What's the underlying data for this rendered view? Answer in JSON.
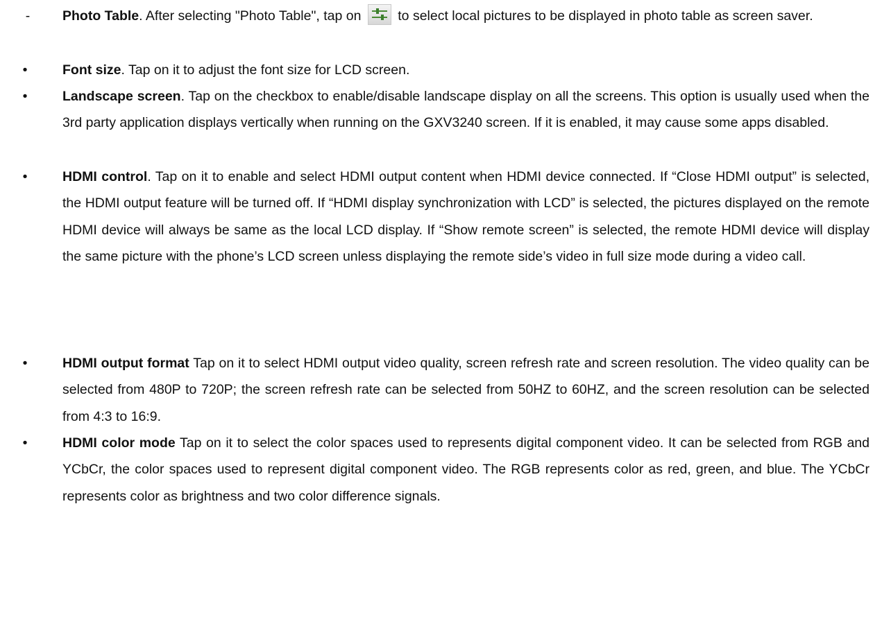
{
  "items": [
    {
      "marker": "-",
      "term": "Photo Table",
      "before_icon": ". After selecting \"Photo Table\", tap on ",
      "icon": "sliders-icon",
      "after_icon": " to select local pictures to be displayed in photo table as screen saver."
    },
    {
      "marker": "•",
      "term": "Font size",
      "text": ". Tap on it to adjust the font size for LCD screen."
    },
    {
      "marker": "•",
      "term": "Landscape screen",
      "text": ". Tap on the checkbox to enable/disable landscape display on all the screens. This option is usually used when the 3rd party application displays vertically when running on the GXV3240 screen. If it is enabled, it may cause some apps disabled."
    },
    {
      "marker": "•",
      "term": "HDMI control",
      "text": ". Tap on it to enable and select HDMI output content when HDMI device connected. If “Close HDMI output” is selected, the HDMI output feature will be turned off. If “HDMI display synchronization with LCD” is selected, the pictures displayed on the remote HDMI device will always be same as the local LCD display. If “Show remote screen” is selected, the remote HDMI device will display the same picture with the phone’s LCD screen unless displaying the remote side’s video in full size mode during a video call."
    },
    {
      "marker": "•",
      "term": "HDMI output format",
      "text": " Tap on it to select HDMI output video quality, screen refresh rate and screen resolution. The video quality can be selected from 480P to 720P; the screen refresh rate can be selected from 50HZ to 60HZ, and the screen resolution can be selected from 4:3 to 16:9."
    },
    {
      "marker": "•",
      "term": "HDMI color mode",
      "text": " Tap on it to select the color spaces used to represents digital component video. It can be selected from RGB and YCbCr, the color spaces used to represent digital component video. The RGB represents color as red, green, and blue. The YCbCr represents color as brightness and two color difference signals."
    }
  ]
}
